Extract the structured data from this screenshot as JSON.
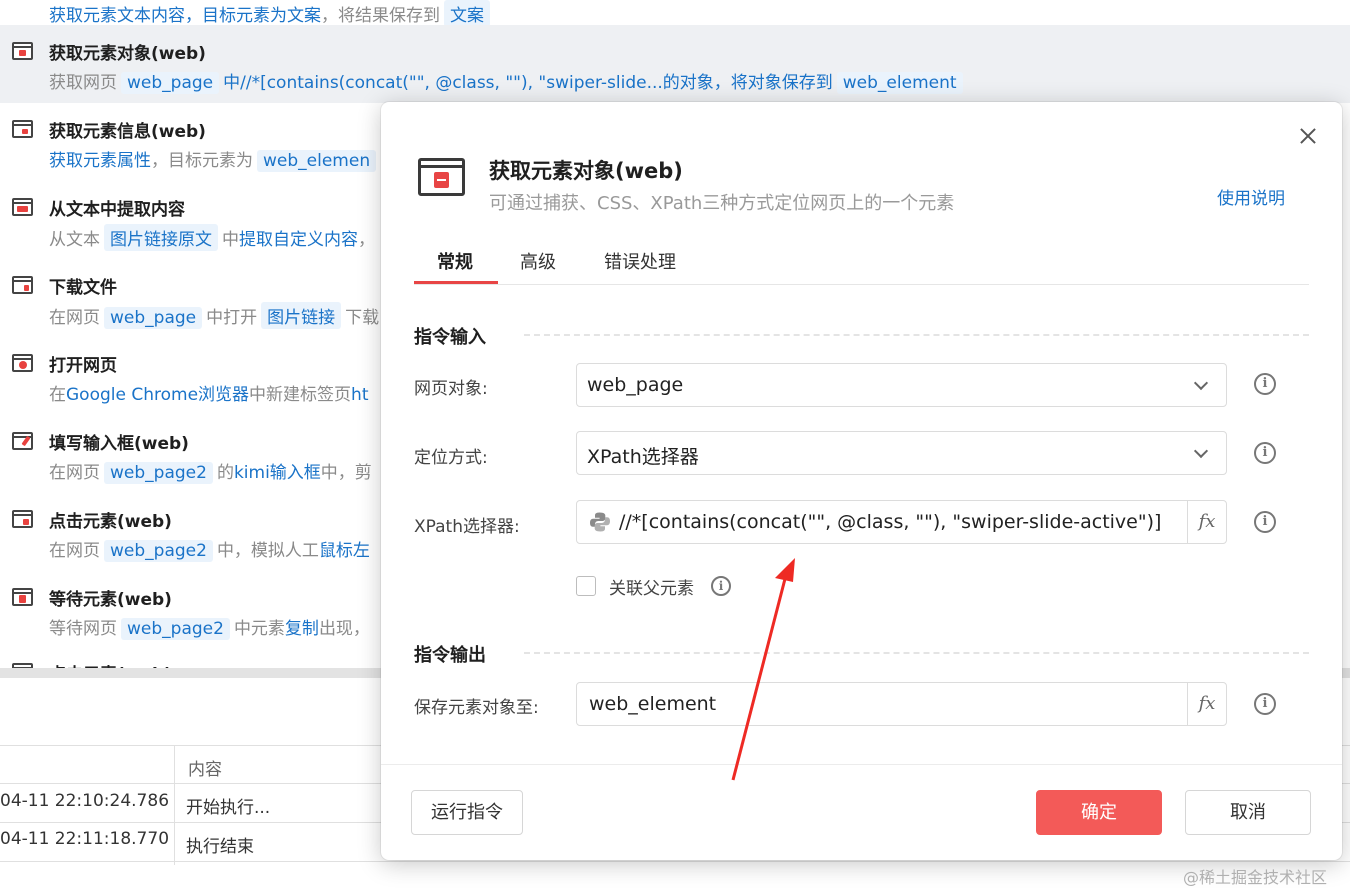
{
  "steps": [
    {
      "title": "",
      "desc_parts": [
        "获取元素文本内容，目标元素为",
        "文案",
        "，将结果保存到",
        "文案"
      ]
    },
    {
      "title": "获取元素对象(web)",
      "desc_parts": [
        "获取网页",
        "web_page",
        "中//*[contains(concat(\"\", @class, \"\"), \"swiper-slide...的对象，将对象保存到",
        "web_element"
      ]
    },
    {
      "title": "获取元素信息(web)",
      "desc_parts": [
        "获取元素属性",
        "，目标元素为",
        "web_elemen"
      ]
    },
    {
      "title": "从文本中提取内容",
      "desc_parts": [
        "从文本",
        "图片链接原文",
        "中",
        "提取自定义内容",
        "，"
      ]
    },
    {
      "title": "下载文件",
      "desc_parts": [
        "在网页",
        "web_page",
        "中打开",
        "图片链接",
        "下载"
      ]
    },
    {
      "title": "打开网页",
      "desc_parts": [
        "在",
        "Google Chrome浏览器",
        "中新建标签页",
        "ht"
      ]
    },
    {
      "title": "填写输入框(web)",
      "desc_parts": [
        "在网页",
        "web_page2",
        "的",
        "kimi输入框",
        "中，剪"
      ]
    },
    {
      "title": "点击元素(web)",
      "desc_parts": [
        "在网页",
        "web_page2",
        "中，模拟人工",
        "鼠标左"
      ]
    },
    {
      "title": "等待元素(web)",
      "desc_parts": [
        "等待网页",
        "web_page2",
        "中元素",
        "复制",
        "出现，"
      ]
    },
    {
      "title": "点击元素(web)",
      "desc_parts": []
    }
  ],
  "log": {
    "header": "内容",
    "rows": [
      {
        "time": "04-11 22:10:24.786",
        "content": "开始执行..."
      },
      {
        "time": "04-11 22:11:18.770",
        "content": "执行结束"
      }
    ]
  },
  "dialog": {
    "title": "获取元素对象(web)",
    "subtitle": "可通过捕获、CSS、XPath三种方式定位网页上的一个元素",
    "help_link": "使用说明",
    "tabs": [
      "常规",
      "高级",
      "错误处理"
    ],
    "active_tab": "常规",
    "input_section": "指令输入",
    "output_section": "指令输出",
    "fields": {
      "web_object": {
        "label": "网页对象:",
        "value": "web_page"
      },
      "locate_method": {
        "label": "定位方式:",
        "value": "XPath选择器"
      },
      "xpath": {
        "label": "XPath选择器:",
        "value": "//*[contains(concat(\"\", @class, \"\"), \"swiper-slide-active\")]"
      },
      "associate_parent": {
        "label": "关联父元素",
        "checked": false
      },
      "save_to": {
        "label": "保存元素对象至:",
        "value": "web_element"
      }
    },
    "fx_label": "fx",
    "buttons": {
      "run": "运行指令",
      "confirm": "确定",
      "cancel": "取消"
    }
  },
  "watermark": "@稀土掘金技术社区",
  "colors": {
    "accent": "#f35a58",
    "link": "#1a73c8",
    "chip_bg": "#eaf3fc",
    "selected_row": "#eef0f3"
  }
}
